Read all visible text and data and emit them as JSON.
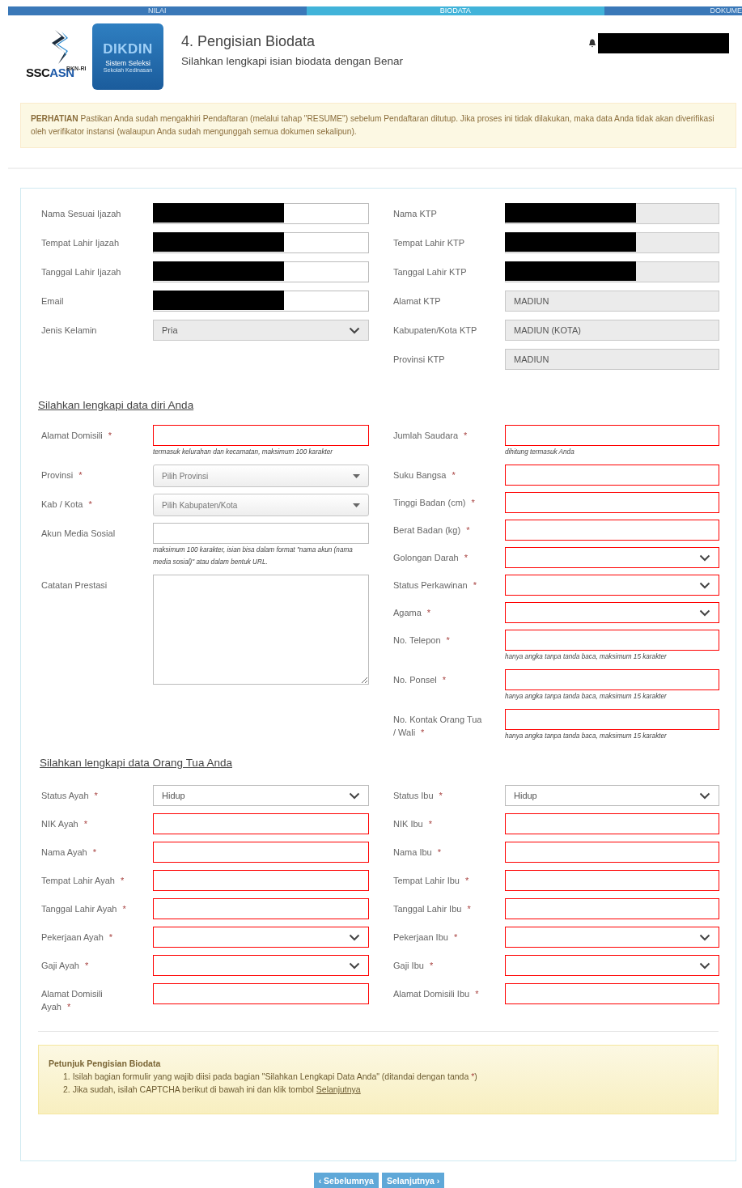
{
  "steps": [
    {
      "label": "NILAI",
      "selected": false
    },
    {
      "label": "BIODATA",
      "selected": true
    },
    {
      "label": "DOKUME",
      "selected": false
    }
  ],
  "header": {
    "logo_small": "BKN-RI",
    "logo_dark": "SSC",
    "logo_blue": "ASN",
    "badge_title": "DIKDIN",
    "badge_subtitle": "Sistem Seleksi",
    "badge_caption": "Sekolah Kedinasan",
    "title": "4. Pengisian Biodata",
    "subtitle": "Silahkan lengkapi isian biodata dengan Benar",
    "user_redacted": true
  },
  "notice": "**PERHATIAN** Pastikan Anda sudah mengakhiri Pendaftaran (melalui tahap \"RESUME\") sebelum Pendaftaran ditutup. Jika proses ini tidak dilakukan, maka data Anda tidak akan diverifikasi oleh verifikator instansi (walaupun Anda sudah mengunggah semua dokumen sekalipun).",
  "identity": {
    "left": [
      {
        "label": "Nama Sesuai Ijazah",
        "kind": "text",
        "readonly": false,
        "invalid": false,
        "redacted": true
      },
      {
        "label": "Tempat Lahir Ijazah",
        "kind": "text",
        "readonly": false,
        "invalid": false,
        "redacted": true
      },
      {
        "label": "Tanggal Lahir Ijazah",
        "kind": "text",
        "readonly": false,
        "invalid": false,
        "redacted": true
      },
      {
        "label": "Email",
        "kind": "text",
        "readonly": false,
        "invalid": false,
        "redacted": true
      },
      {
        "label": "Jenis Kelamin",
        "kind": "select",
        "value": "Pria",
        "readonly": true,
        "invalid": false
      }
    ],
    "right": [
      {
        "label": "Nama KTP",
        "kind": "text",
        "readonly": true,
        "invalid": false,
        "redacted": true
      },
      {
        "label": "Tempat Lahir KTP",
        "kind": "text",
        "readonly": true,
        "invalid": false,
        "redacted": true
      },
      {
        "label": "Tanggal Lahir KTP",
        "kind": "text",
        "readonly": true,
        "invalid": false,
        "redacted": true
      },
      {
        "label": "Alamat KTP",
        "kind": "text",
        "value": "MADIUN",
        "readonly": true,
        "invalid": false
      },
      {
        "label": "Kabupaten/Kota KTP",
        "kind": "text",
        "value": "MADIUN (KOTA)",
        "readonly": true,
        "invalid": false
      },
      {
        "label": "Provinsi KTP",
        "kind": "text",
        "value": "MADIUN",
        "readonly": true,
        "invalid": false
      }
    ]
  },
  "personal": {
    "title": "Silahkan lengkapi data diri Anda",
    "left": [
      {
        "label": "Alamat Domisili",
        "mark": "*",
        "kind": "text",
        "readonly": false,
        "invalid": true,
        "hint": "termasuk kelurahan dan kecamatan, maksimum 100 karakter"
      },
      {
        "label": "Provinsi",
        "mark": "*",
        "kind": "combo",
        "placeholder": "Pilih Provinsi",
        "readonly": false,
        "invalid": false
      },
      {
        "label": "Kab / Kota",
        "mark": "*",
        "kind": "combo",
        "placeholder": "Pilih Kabupaten/Kota",
        "readonly": false,
        "invalid": false
      },
      {
        "label": "Akun Media Sosial",
        "kind": "text",
        "readonly": false,
        "invalid": false,
        "hint": "maksimum 100 karakter, isian bisa dalam format \"nama akun (nama media sosial)\" atau dalam bentuk URL."
      },
      {
        "label": "Catatan Prestasi",
        "kind": "textarea",
        "readonly": false,
        "invalid": false
      }
    ],
    "right": [
      {
        "label": "Jumlah Saudara",
        "mark": "*",
        "kind": "text",
        "readonly": false,
        "invalid": true,
        "hint": "dihitung termasuk Anda"
      },
      {
        "label": "Suku Bangsa",
        "mark": "*",
        "kind": "text",
        "readonly": false,
        "invalid": true
      },
      {
        "label": "Tinggi Badan (cm)",
        "mark": "*",
        "kind": "text",
        "readonly": false,
        "invalid": true
      },
      {
        "label": "Berat Badan (kg)",
        "mark": "*",
        "kind": "text",
        "readonly": false,
        "invalid": true
      },
      {
        "label": "Golongan Darah",
        "mark": "*",
        "kind": "select",
        "readonly": false,
        "invalid": true
      },
      {
        "label": "Status Perkawinan",
        "mark": "*",
        "kind": "select",
        "readonly": false,
        "invalid": true
      },
      {
        "label": "Agama",
        "mark": "*",
        "kind": "select",
        "readonly": false,
        "invalid": true
      },
      {
        "label": "No. Telepon",
        "mark": "*",
        "kind": "text",
        "readonly": false,
        "invalid": true,
        "hint": "hanya angka tanpa tanda baca, maksimum 15 karakter"
      },
      {
        "label": "No. Ponsel",
        "mark": "*",
        "kind": "text",
        "readonly": false,
        "invalid": true,
        "hint": "hanya angka tanpa tanda baca, maksimum 15 karakter"
      },
      {
        "label": "No. Kontak Orang Tua / Wali",
        "mark": "*",
        "kind": "text",
        "readonly": false,
        "invalid": true,
        "hint": "hanya angka tanpa tanda baca, maksimum 15 karakter"
      }
    ]
  },
  "parents": {
    "title": "Silahkan lengkapi data Orang Tua Anda",
    "left": [
      {
        "label": "Status Ayah",
        "mark": "*",
        "kind": "select",
        "value": "Hidup",
        "readonly": false,
        "invalid": false
      },
      {
        "label": "NIK Ayah",
        "mark": "*",
        "kind": "text",
        "readonly": false,
        "invalid": true
      },
      {
        "label": "Nama Ayah",
        "mark": "*",
        "kind": "text",
        "readonly": false,
        "invalid": true
      },
      {
        "label": "Tempat Lahir Ayah",
        "mark": "*",
        "kind": "text",
        "readonly": false,
        "invalid": true
      },
      {
        "label": "Tanggal Lahir Ayah",
        "mark": "*",
        "kind": "text",
        "readonly": false,
        "invalid": true
      },
      {
        "label": "Pekerjaan Ayah",
        "mark": "*",
        "kind": "select",
        "readonly": false,
        "invalid": true
      },
      {
        "label": "Gaji Ayah",
        "mark": "*",
        "kind": "select",
        "readonly": false,
        "invalid": true
      },
      {
        "label": "Alamat Domisili Ayah",
        "mark": "*",
        "kind": "text",
        "readonly": false,
        "invalid": true
      }
    ],
    "right": [
      {
        "label": "Status Ibu",
        "mark": "*",
        "kind": "select",
        "value": "Hidup",
        "readonly": false,
        "invalid": false
      },
      {
        "label": "NIK Ibu",
        "mark": "*",
        "kind": "text",
        "readonly": false,
        "invalid": true
      },
      {
        "label": "Nama Ibu",
        "mark": "*",
        "kind": "text",
        "readonly": false,
        "invalid": true
      },
      {
        "label": "Tempat Lahir Ibu",
        "mark": "*",
        "kind": "text",
        "readonly": false,
        "invalid": true
      },
      {
        "label": "Tanggal Lahir Ibu",
        "mark": "*",
        "kind": "text",
        "readonly": false,
        "invalid": true
      },
      {
        "label": "Pekerjaan Ibu",
        "mark": "*",
        "kind": "select",
        "readonly": false,
        "invalid": true
      },
      {
        "label": "Gaji Ibu",
        "mark": "*",
        "kind": "select",
        "readonly": false,
        "invalid": true
      },
      {
        "label": "Alamat Domisili Ibu",
        "mark": "*",
        "kind": "text",
        "readonly": false,
        "invalid": true
      }
    ]
  },
  "instructions": {
    "title": "Petunjuk Pengisian Biodata",
    "items": [
      {
        "text": "1. Isilah bagian formulir yang wajib diisi pada bagian \"Silahkan Lengkapi Data Anda\" (ditandai dengan tanda ",
        "mark": "*",
        "after": ")"
      },
      {
        "text": "2. Jika sudah, isilah CAPTCHA berikut di bawah ini dan klik tombol ",
        "link": "Selanjutnya"
      }
    ]
  },
  "buttons": [
    "‹ Sebelumnya",
    "Selanjutnya ›"
  ]
}
